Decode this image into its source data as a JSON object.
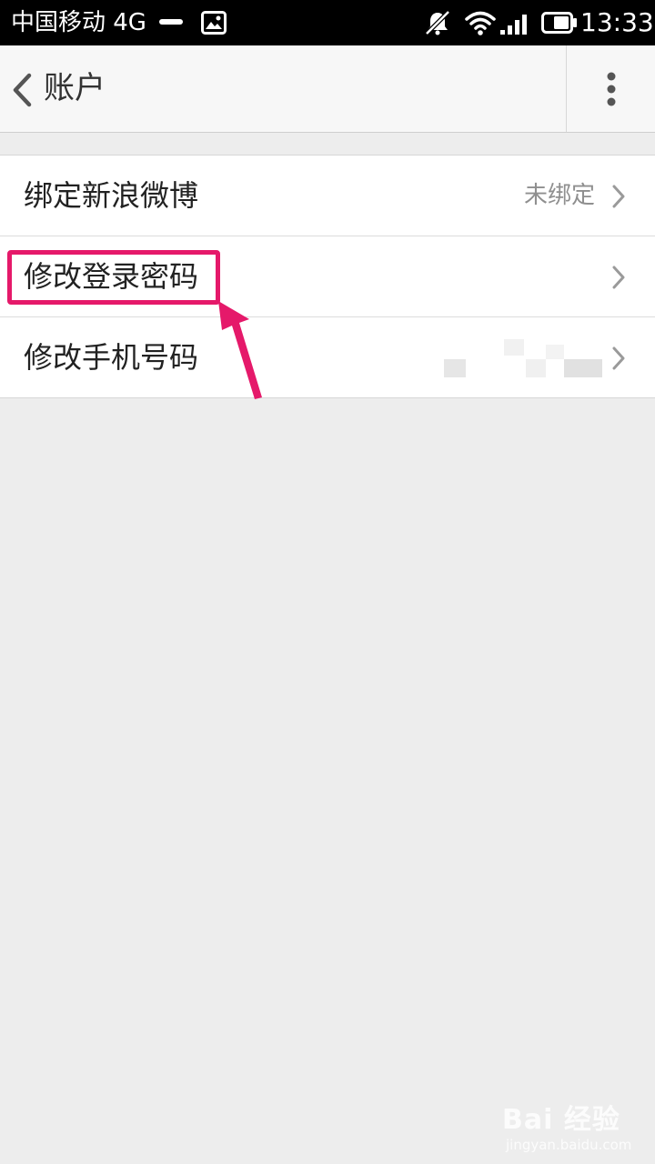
{
  "status_bar": {
    "carrier": "中国移动 4G",
    "time": "13:33",
    "icons": [
      "minus-icon",
      "image-icon",
      "mute-icon",
      "wifi-icon",
      "signal-icon",
      "battery-icon"
    ]
  },
  "app_bar": {
    "title": "账户",
    "icons": [
      "back-icon",
      "more-vert-icon"
    ]
  },
  "settings": {
    "items": [
      {
        "label": "绑定新浪微博",
        "value": "未绑定"
      },
      {
        "label": "修改登录密码",
        "value": ""
      },
      {
        "label": "修改手机号码",
        "value": ""
      }
    ]
  },
  "annotation": {
    "highlight_color": "#e5196a"
  },
  "watermark": {
    "logo": "Bai 经验",
    "url": "jingyan.baidu.com"
  }
}
